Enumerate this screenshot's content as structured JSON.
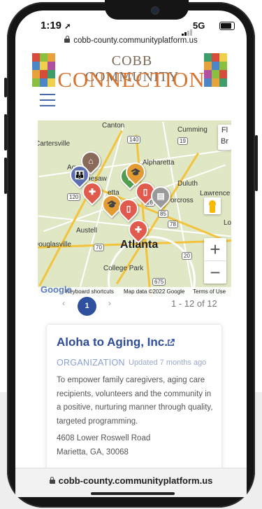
{
  "status": {
    "time": "1:19",
    "network": "5G"
  },
  "browser": {
    "url_top": "cobb-county.communityplatform.us",
    "url_bottom": "cobb-county.communityplatform.us"
  },
  "logo": {
    "line1": "COBB COMMUNITY",
    "line2": "CONNECTION"
  },
  "map": {
    "labels": {
      "canton": "Canton",
      "cumming": "Cumming",
      "cartersville": "Cartersville",
      "alpharetta": "Alpharetta",
      "acworth": "Acw",
      "kennesaw": "nesaw",
      "duluth": "Duluth",
      "lawrence": "Lawrence",
      "norcross": "orcross",
      "marietta": "etta",
      "austell": "Austell",
      "douglasville": "Douglasville",
      "atlanta": "Atlanta",
      "college_park": "College Park",
      "lo": "Lo",
      "fl": "Fl",
      "br": "Br"
    },
    "badges": {
      "b140": "140",
      "b19": "19",
      "b120": "120",
      "b28": "28",
      "b85": "85",
      "b78": "78",
      "b70": "70",
      "b20": "20",
      "b675": "675"
    },
    "attribution": {
      "keyboard": "Keyboard shortcuts",
      "data": "Map data ©2022 Google",
      "terms": "Terms of Use",
      "google": "Google"
    },
    "zoom": {
      "plus": "+",
      "minus": "−"
    }
  },
  "pagination": {
    "prev": "‹",
    "current": "1",
    "next": "›",
    "count": "1 - 12 of 12"
  },
  "card": {
    "title": "Aloha to Aging, Inc.",
    "type": "ORGANIZATION",
    "updated": "Updated 7 months ago",
    "description": "To empower family caregivers, aging care recipients, volunteers and the community in a positive, nurturing manner through quality, targeted programming.",
    "address_line1": "4608 Lower Roswell Road",
    "address_line2": "Marietta, GA, 30068"
  },
  "colors": {
    "accent": "#2f4f9f",
    "logo_orange": "#d67532",
    "pin_red": "#e05a4e",
    "pin_orange": "#e39b35"
  }
}
